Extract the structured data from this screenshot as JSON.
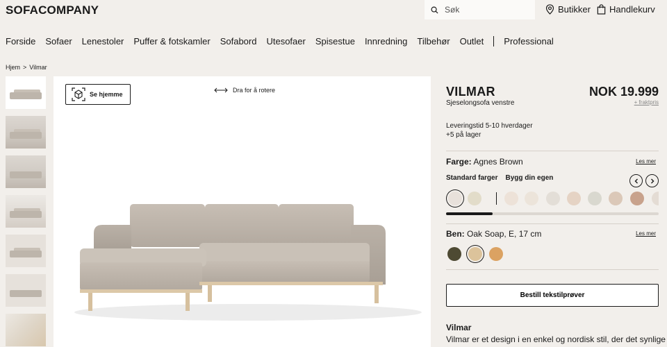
{
  "header": {
    "logo": "SOFACOMPANY",
    "search_placeholder": "Søk",
    "stores_label": "Butikker",
    "cart_label": "Handlekurv"
  },
  "nav": {
    "items": [
      "Forside",
      "Sofaer",
      "Lenestoler",
      "Puffer & fotskamler",
      "Sofabord",
      "Utesofaer",
      "Spisestue",
      "Innredning",
      "Tilbehør",
      "Outlet"
    ],
    "professional": "Professional"
  },
  "breadcrumb": {
    "home": "Hjem",
    "separator": ">",
    "current": "Vilmar"
  },
  "viewer": {
    "ar_button": "Se hjemme",
    "rotate_hint": "Dra for å rotere"
  },
  "product": {
    "name": "VILMAR",
    "subtitle": "Sjeselongsofa venstre",
    "price": "NOK 19.999",
    "freight": "+ fraktpris",
    "delivery": "Leveringstid 5-10 hverdager",
    "stock": "+5 på lager",
    "color": {
      "label": "Farge:",
      "value": "Agnes Brown",
      "read_more": "Les mer",
      "tab_standard": "Standard farger",
      "tab_custom": "Bygg din egen",
      "swatches": [
        "#e8e1db",
        "#e2dcc9",
        "#ede2d8",
        "#ece4da",
        "#e3ded7",
        "#e5d3c4",
        "#d9d8cf",
        "#dbc8b8",
        "#c8a28c",
        "#e4dcd4"
      ],
      "scroll_fraction": 0.22
    },
    "legs": {
      "label": "Ben:",
      "value": "Oak Soap, E, 17 cm",
      "read_more": "Les mer",
      "options": [
        "#4e4a33",
        "#dcc39b",
        "#dba262"
      ]
    },
    "order_samples": "Bestill tekstilprøver",
    "description_title": "Vilmar",
    "description_text": "Vilmar er et design i en enkel og nordisk stil, der det synlige"
  },
  "colors": {
    "background": "#f2efeb",
    "fabric": "#bfb6ac",
    "wood": "#dcc8a8"
  }
}
